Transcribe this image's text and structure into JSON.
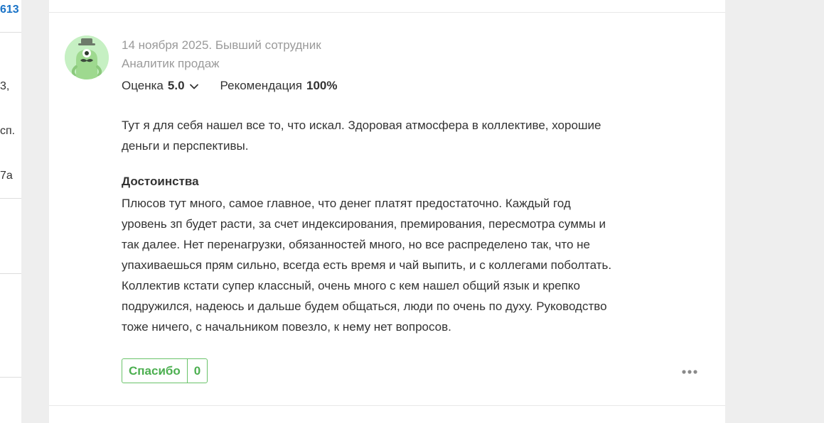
{
  "sidebar_fragments": [
    {
      "text": "613"
    },
    {
      "text": "3,"
    },
    {
      "text": "сп."
    },
    {
      "text": "7а"
    }
  ],
  "review": {
    "date_and_status": "14 ноября 2025. Бывший сотрудник",
    "position": "Аналитик продаж",
    "rating_label": "Оценка",
    "rating_value": "5.0",
    "recommendation_label": "Рекомендация",
    "recommendation_value": "100%",
    "summary_lines": [
      "Тут я для себя нашел все то, что искал. Здоровая атмосфера в коллективе, хорошие",
      "деньги и перспективы."
    ],
    "pros_title": "Достоинства",
    "pros_lines": [
      "Плюсов тут много, самое главное, что денег платят предостаточно. Каждый год",
      "уровень зп будет расти, за счет индексирования, премирования, пересмотра суммы и",
      "так далее. Нет перенагрузки, обязанностей много, но все распределено так, что не",
      "упахиваешься прям сильно, всегда есть время и чай выпить, и с коллегами поболтать.",
      "Коллектив кстати супер классный, очень много с кем нашел общий язык и крепко",
      "подружился, надеюсь и дальше будем общаться, люди по очень по духу. Руководство",
      "тоже ничего, с начальником повезло, к нему нет вопросов."
    ],
    "thanks_label": "Спасибо",
    "thanks_count": "0"
  },
  "colors": {
    "accent_green": "#4caf50",
    "link_blue": "#1a73c7",
    "meta_gray": "#9a9a9a",
    "avatar_bg": "#c6f0c3"
  },
  "icons": {
    "avatar": "cyclops-monster-avatar-icon",
    "rating_dropdown": "chevron-down-icon",
    "more": "more-dots-icon"
  }
}
